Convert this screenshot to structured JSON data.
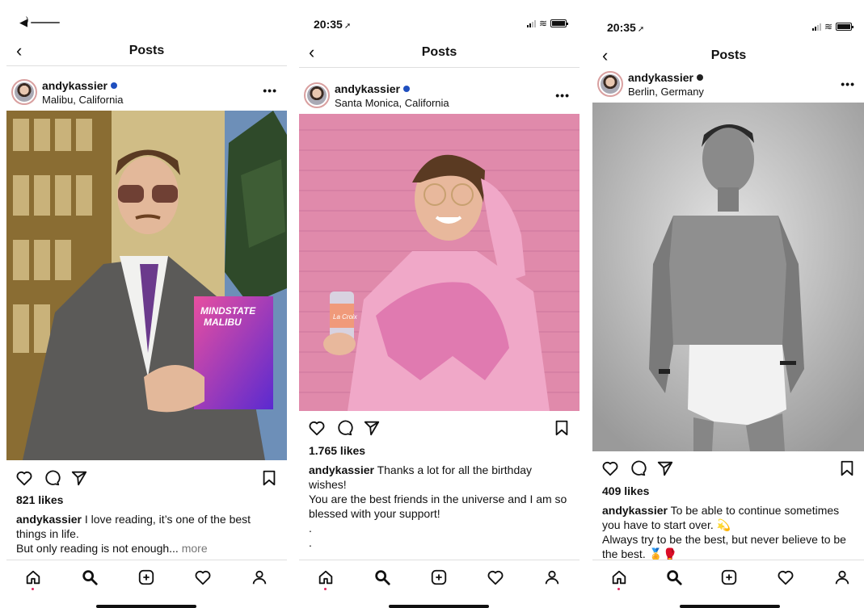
{
  "phones": [
    {
      "status": {
        "time": "",
        "volume": true
      },
      "header": {
        "title": "Posts"
      },
      "post": {
        "username": "andykassier",
        "location": "Malibu, California",
        "likes": "821 likes",
        "caption_user": "andykassier",
        "caption_text": " I love reading, it’s one of the best things in life.",
        "caption_line2": "But only reading is not enough...",
        "more_label": " more",
        "book_title": "MINDSTATE MALIBU"
      }
    },
    {
      "status": {
        "time": "20:35",
        "location_arrow": "➚"
      },
      "header": {
        "title": "Posts"
      },
      "post": {
        "username": "andykassier",
        "location": "Santa Monica, California",
        "likes": "1.765 likes",
        "caption_user": "andykassier",
        "caption_text": " Thanks a lot for all the birthday wishes!",
        "caption_line2": "You are the best friends in the universe and I am so blessed with your support!",
        "caption_line3": ".",
        "caption_line4": ".",
        "can_label": "La Croix"
      }
    },
    {
      "status": {
        "time": "20:35",
        "location_arrow": "➚"
      },
      "header": {
        "title": "Posts"
      },
      "post": {
        "username": "andykassier",
        "location": "Berlin, Germany",
        "likes": "409 likes",
        "caption_user": "andykassier",
        "caption_text": " To be able to continue sometimes you have to start over. 💫",
        "caption_line2": "Always try to be the best, but never believe to be the best. 🏅🥊"
      }
    }
  ],
  "icons": {
    "back": "chevron-left-icon",
    "more": "more-dots-icon",
    "like": "heart-outline-icon",
    "comment": "comment-bubble-icon",
    "share": "paper-plane-icon",
    "save": "bookmark-icon",
    "tab_home": "home-icon",
    "tab_search": "search-icon",
    "tab_add": "add-post-icon",
    "tab_activity": "heart-icon",
    "tab_profile": "profile-icon"
  },
  "ui": {
    "back_glyph": "‹",
    "more_glyph": "•••"
  },
  "colors": {
    "verified": "#1f4fbf",
    "notification_dot": "#e0245e"
  }
}
